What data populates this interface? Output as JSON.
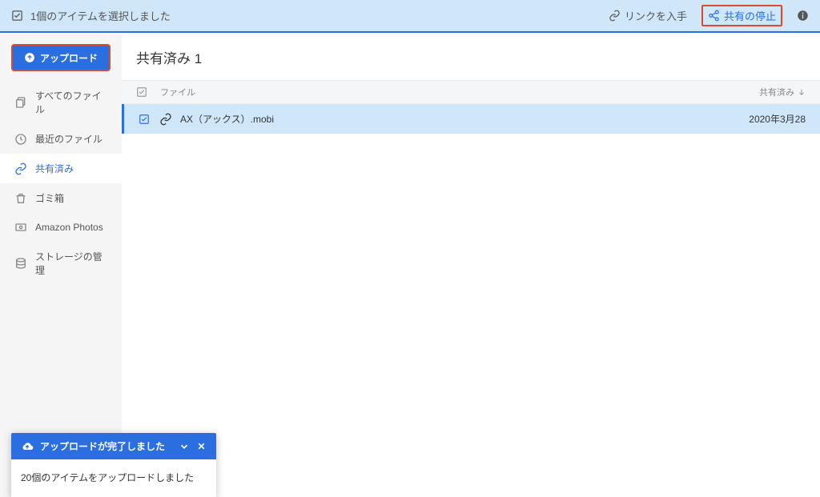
{
  "topbar": {
    "selection_text": "1個のアイテムを選択しました",
    "get_link": "リンクを入手",
    "stop_share": "共有の停止",
    "info_icon": "情"
  },
  "tooltip": "共有の停止",
  "sidebar": {
    "upload_label": "アップロード",
    "items": [
      {
        "label": "すべてのファイル"
      },
      {
        "label": "最近のファイル"
      },
      {
        "label": "共有済み"
      },
      {
        "label": "ゴミ箱"
      },
      {
        "label": "Amazon Photos"
      },
      {
        "label": "ストレージの管理"
      }
    ]
  },
  "main": {
    "title": "共有済み  1",
    "columns": {
      "file": "ファイル",
      "shared": "共有済み"
    },
    "rows": [
      {
        "name": "AX（アックス）.mobi",
        "date": "2020年3月28"
      }
    ]
  },
  "toast": {
    "title": "アップロードが完了しました",
    "body": "20個のアイテムをアップロードしました"
  }
}
